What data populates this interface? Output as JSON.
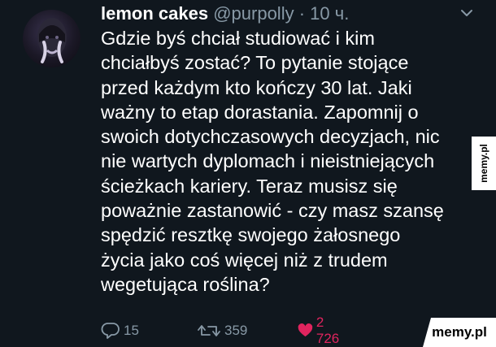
{
  "tweet": {
    "author_name": "lemon cakes",
    "handle": "@purpolly",
    "separator": "·",
    "time": "10 ч.",
    "text_lines": [
      "Gdzie byś chciał studiować i kim",
      "chciałbyś zostać? To pytanie stojące",
      "przed każdym kto kończy 30 lat. Jaki",
      "ważny to etap dorastania. Zapomnij o",
      "swoich dotychczasowych decyzjach, nic",
      "nie wartych dyplomach i nieistniejących",
      "ścieżkach kariery. Teraz musisz się",
      "poważnie zastanowić - czy masz szansę",
      "spędzić resztkę swojego żałosnego",
      "życia jako coś więcej niż z trudem",
      "wegetująca roślina?"
    ],
    "actions": {
      "reply_count": "15",
      "retweet_count": "359",
      "like_count": "2 726"
    },
    "icons": {
      "avatar": "avatar-icon",
      "menu": "chevron-down-icon",
      "reply": "reply-icon",
      "retweet": "retweet-icon",
      "like": "heart-icon"
    }
  },
  "watermarks": {
    "side": "memy.pl",
    "corner": "memy.pl"
  },
  "colors": {
    "background": "#10171e",
    "text": "#ffffff",
    "secondary": "#8899a6",
    "like": "#e0245e"
  }
}
